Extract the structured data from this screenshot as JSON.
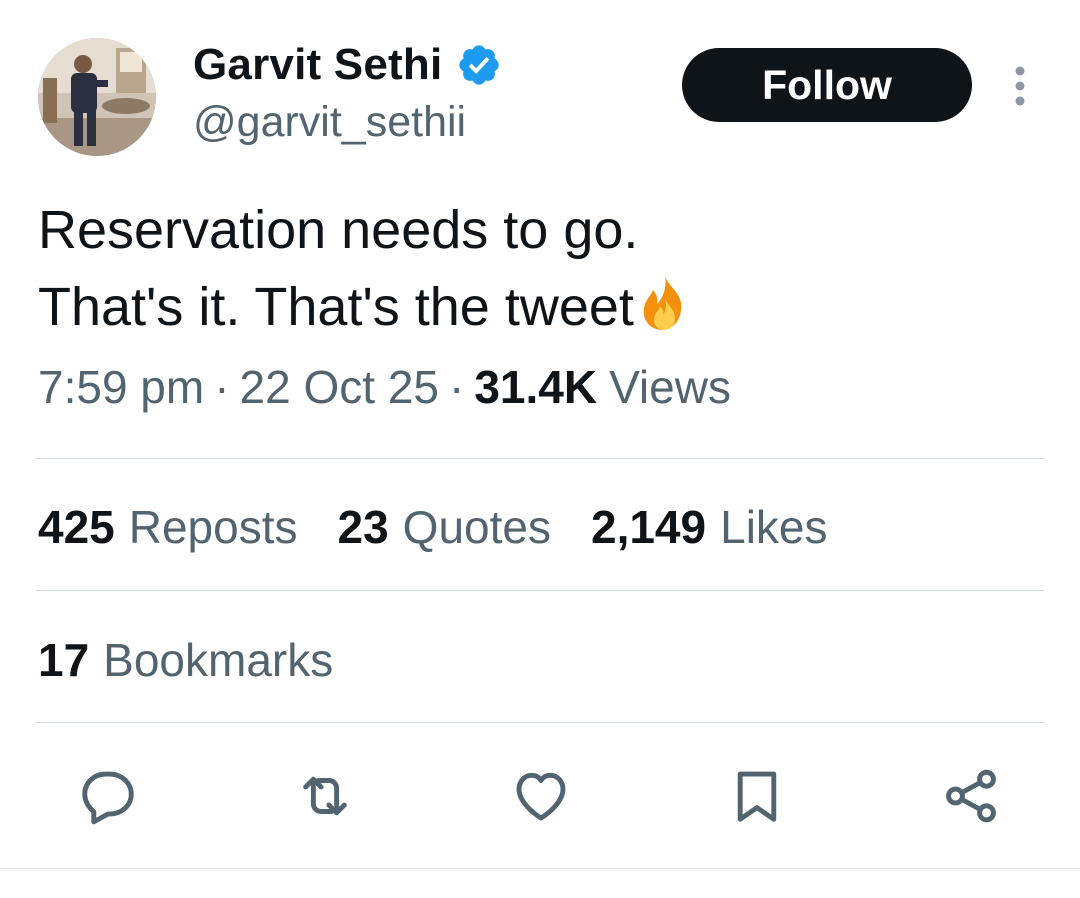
{
  "author": {
    "display_name": "Garvit Sethi",
    "handle": "@garvit_sethii",
    "verified": true,
    "verified_color": "#1d9bf0"
  },
  "follow_button": {
    "label": "Follow"
  },
  "more_menu": {
    "icon": "more-vertical-icon"
  },
  "tweet": {
    "lines": [
      "Reservation needs to go.",
      "That's it. That's the tweet"
    ],
    "emoji": "fire-icon"
  },
  "meta": {
    "time": "7:59 pm",
    "separator": "·",
    "date": "22 Oct 25",
    "views_count": "31.4K",
    "views_label": "Views"
  },
  "stats": {
    "reposts": {
      "count": "425",
      "label": "Reposts"
    },
    "quotes": {
      "count": "23",
      "label": "Quotes"
    },
    "likes": {
      "count": "2,149",
      "label": "Likes"
    },
    "bookmarks": {
      "count": "17",
      "label": "Bookmarks"
    }
  },
  "actions": [
    "reply-icon",
    "repost-icon",
    "like-icon",
    "bookmark-icon",
    "share-icon"
  ],
  "colors": {
    "text_primary": "#0f1419",
    "text_secondary": "#536471",
    "divider": "#cfd9de",
    "button_bg": "#0f1419"
  }
}
